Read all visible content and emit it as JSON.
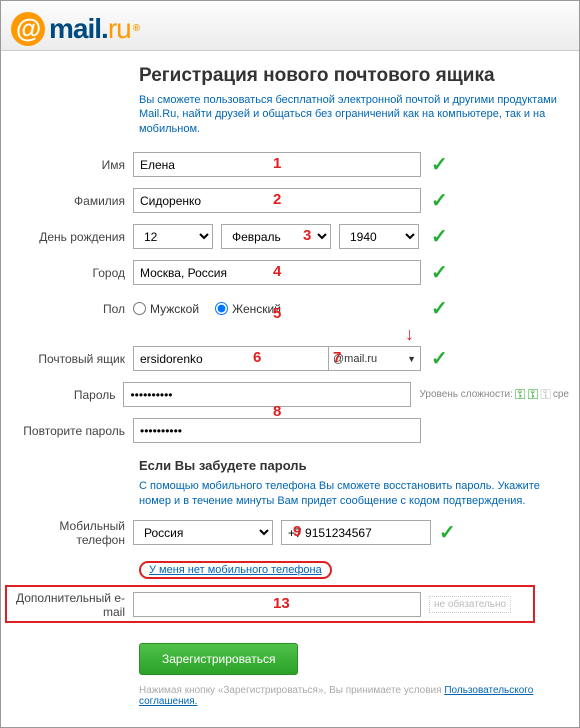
{
  "logo": {
    "brand_main": "mail",
    "brand_dot": ".",
    "brand_ru": "ru"
  },
  "heading": "Регистрация нового почтового ящика",
  "intro": "Вы сможете пользоваться бесплатной электронной почтой и другими продуктами Mail.Ru, найти друзей и общаться без ограничений как на компьютере, так и на мобильном.",
  "labels": {
    "first_name": "Имя",
    "last_name": "Фамилия",
    "dob": "День рождения",
    "city": "Город",
    "gender": "Пол",
    "gender_m": "Мужской",
    "gender_f": "Женский",
    "mailbox": "Почтовый ящик",
    "password": "Пароль",
    "password_repeat": "Повторите пароль",
    "mobile": "Мобильный телефон",
    "alt_email": "Дополнительный e-mail"
  },
  "values": {
    "first_name": "Елена",
    "last_name": "Сидоренко",
    "day": "12",
    "month": "Февраль",
    "year": "1940",
    "city": "Москва, Россия",
    "login": "ersidorenko",
    "domain": "@mail.ru",
    "password_masked": "●●●●●●●●●●",
    "phone_country": "Россия",
    "phone_number": "+7 9151234567",
    "alt_email": ""
  },
  "forgot": {
    "heading": "Если Вы забудете пароль",
    "text": "С помощью мобильного телефона Вы сможете восстановить пароль. Укажите номер и в течение минуты Вам придет сообщение с кодом подтверждения.",
    "no_phone_link": "У меня нет мобильного телефона"
  },
  "strength_label": "Уровень сложности:",
  "strength_word": "сре",
  "optional_tag": "не обязательно",
  "submit": "Зарегистрироваться",
  "tos_prefix": "Нажимая кнопку «Зарегистрироваться», Вы принимаете условия ",
  "tos_link": "Пользовательского соглашения.",
  "annotations": {
    "n1": "1",
    "n2": "2",
    "n3": "3",
    "n4": "4",
    "n5": "5",
    "n6": "6",
    "n7": "7",
    "n8": "8",
    "n9": "9",
    "n13": "13"
  }
}
